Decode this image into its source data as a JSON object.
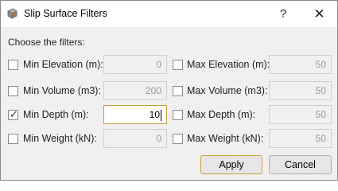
{
  "window": {
    "title": "Slip Surface Filters",
    "help_label": "?",
    "close_label": "✕"
  },
  "prompt": "Choose the filters:",
  "filters": [
    {
      "label": "Min Elevation (m):",
      "value": "0",
      "checked": false
    },
    {
      "label": "Max Elevation (m):",
      "value": "50",
      "checked": false
    },
    {
      "label": "Min Volume (m3):",
      "value": "200",
      "checked": false
    },
    {
      "label": "Max Volume (m3):",
      "value": "50",
      "checked": false
    },
    {
      "label": "Min Depth (m):",
      "value": "10",
      "checked": true
    },
    {
      "label": "Max Depth (m):",
      "value": "50",
      "checked": false
    },
    {
      "label": "Min Weight (kN):",
      "value": "0",
      "checked": false
    },
    {
      "label": "Max Weight (kN):",
      "value": "50",
      "checked": false
    }
  ],
  "check_glyph": "✓",
  "buttons": {
    "apply": "Apply",
    "cancel": "Cancel"
  },
  "colors": {
    "focus_border": "#c9a03a",
    "disabled_text": "#9a9a9a"
  }
}
